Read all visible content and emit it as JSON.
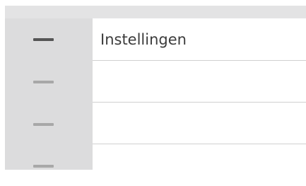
{
  "settings_list": {
    "items": [
      {
        "label": "Instellingen"
      },
      {
        "label": ""
      },
      {
        "label": ""
      },
      {
        "label": ""
      }
    ]
  },
  "colors": {
    "sidebar_bg": "#dcdcdd",
    "active_mark": "#555555",
    "inactive_mark": "#a8a8a8",
    "divider": "#d0d0d0"
  }
}
